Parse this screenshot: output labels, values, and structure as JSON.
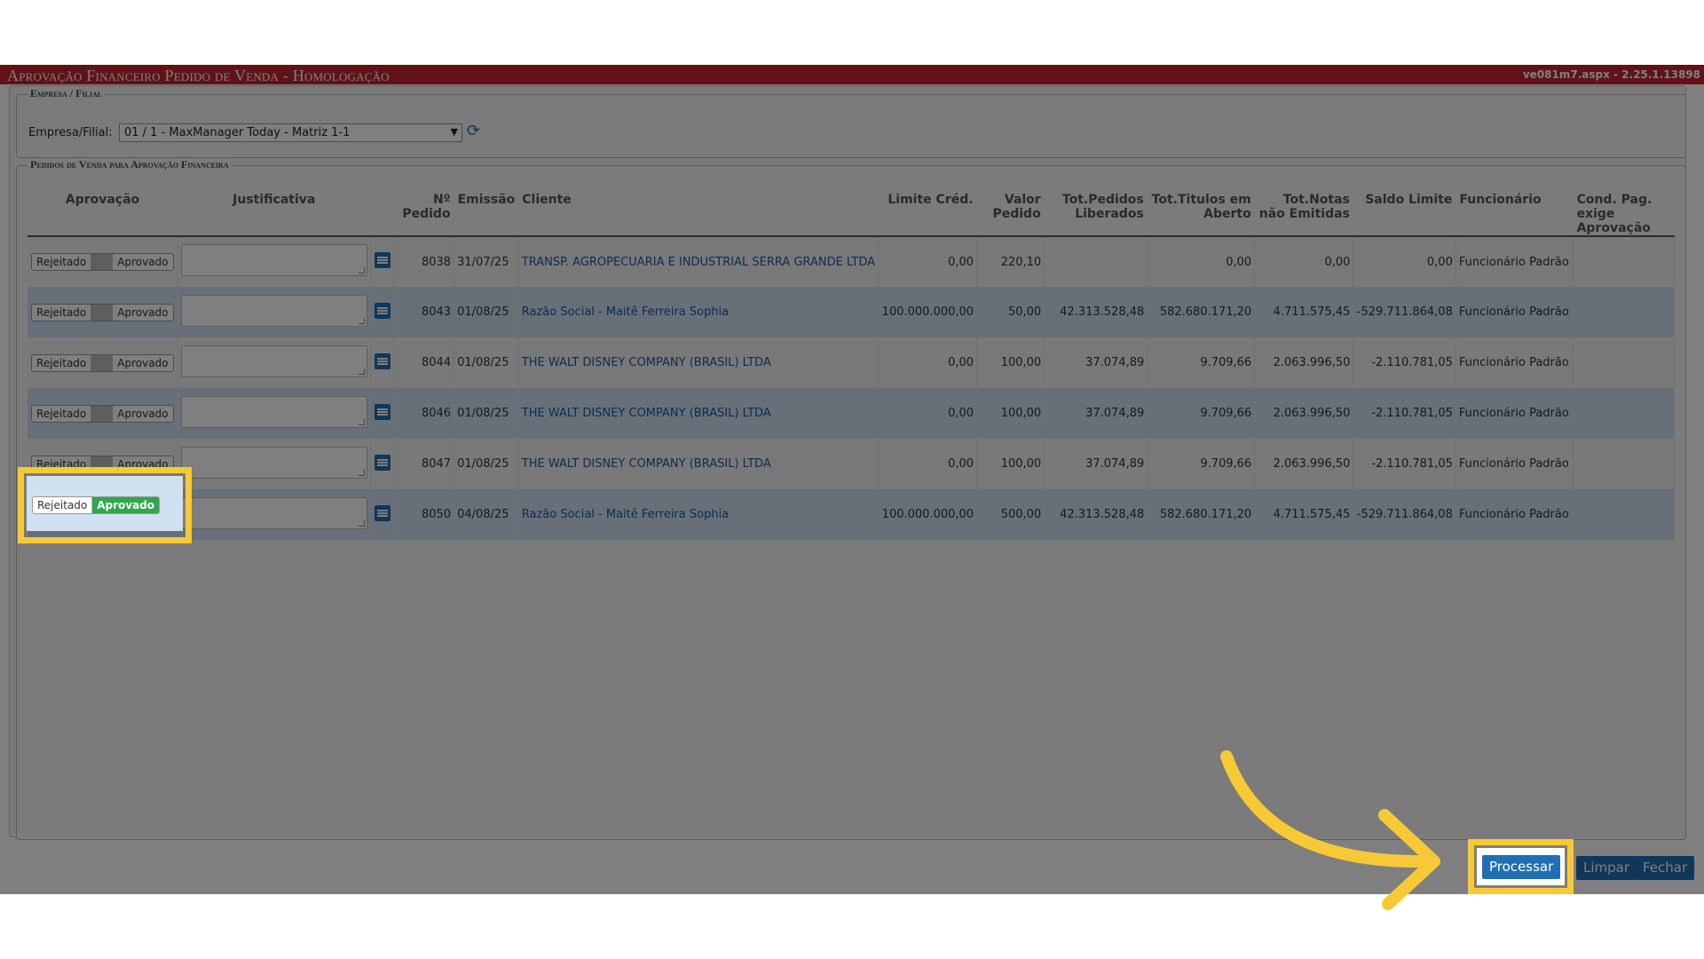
{
  "window": {
    "title": "Aprovação Financeiro Pedido de Venda  - Homologação",
    "version": "ve081m7.aspx - 2.25.1.13898"
  },
  "empresa": {
    "legend": "Empresa / Filial",
    "label": "Empresa/Filial:",
    "selected": "01 / 1 - MaxManager Today - Matriz 1-1"
  },
  "pedidos": {
    "legend": "Pedidos de Venda para Aprovação Financeira",
    "headers": {
      "aprovacao": "Aprovação",
      "justificativa": "Justificativa",
      "pedido": "Nº Pedido",
      "emissao": "Emissão",
      "cliente": "Cliente",
      "limite": "Limite Créd.",
      "valor": "Valor Pedido",
      "tot_liberados": "Tot.Pedidos Liberados",
      "tot_titulos": "Tot.Titulos em Aberto",
      "tot_notas": "Tot.Notas não Emitidas",
      "saldo": "Saldo Limite",
      "funcionario": "Funcionário",
      "cond": "Cond. Pag. exige Aprovação"
    },
    "toggle": {
      "rejeitado": "Rejeitado",
      "aprovado": "Aprovado"
    },
    "rows": [
      {
        "pedido": "8038",
        "emissao": "31/07/25",
        "cliente": "TRANSP. AGROPECUARIA E INDUSTRIAL SERRA GRANDE LTDA",
        "limite": "0,00",
        "valor": "220,10",
        "tot_liberados": "",
        "tot_titulos": "0,00",
        "tot_notas": "0,00",
        "saldo": "0,00",
        "funcionario": "Funcionário Padrão",
        "cond": "",
        "aprovado": false
      },
      {
        "pedido": "8043",
        "emissao": "01/08/25",
        "cliente": "Razão Social - Maitê Ferreira Sophia",
        "limite": "100.000.000,00",
        "valor": "50,00",
        "tot_liberados": "42.313.528,48",
        "tot_titulos": "582.680.171,20",
        "tot_notas": "4.711.575,45",
        "saldo": "-529.711.864,08",
        "funcionario": "Funcionário Padrão",
        "cond": "",
        "aprovado": false
      },
      {
        "pedido": "8044",
        "emissao": "01/08/25",
        "cliente": "THE WALT DISNEY COMPANY (BRASIL) LTDA",
        "limite": "0,00",
        "valor": "100,00",
        "tot_liberados": "37.074,89",
        "tot_titulos": "9.709,66",
        "tot_notas": "2.063.996,50",
        "saldo": "-2.110.781,05",
        "funcionario": "Funcionário Padrão",
        "cond": "",
        "aprovado": false
      },
      {
        "pedido": "8046",
        "emissao": "01/08/25",
        "cliente": "THE WALT DISNEY COMPANY (BRASIL) LTDA",
        "limite": "0,00",
        "valor": "100,00",
        "tot_liberados": "37.074,89",
        "tot_titulos": "9.709,66",
        "tot_notas": "2.063.996,50",
        "saldo": "-2.110.781,05",
        "funcionario": "Funcionário Padrão",
        "cond": "",
        "aprovado": false
      },
      {
        "pedido": "8047",
        "emissao": "01/08/25",
        "cliente": "THE WALT DISNEY COMPANY (BRASIL) LTDA",
        "limite": "0,00",
        "valor": "100,00",
        "tot_liberados": "37.074,89",
        "tot_titulos": "9.709,66",
        "tot_notas": "2.063.996,50",
        "saldo": "-2.110.781,05",
        "funcionario": "Funcionário Padrão",
        "cond": "",
        "aprovado": false
      },
      {
        "pedido": "8050",
        "emissao": "04/08/25",
        "cliente": "Razão Social - Maitê Ferreira Sophia",
        "limite": "100.000.000,00",
        "valor": "500,00",
        "tot_liberados": "42.313.528,48",
        "tot_titulos": "582.680.171,20",
        "tot_notas": "4.711.575,45",
        "saldo": "-529.711.864,08",
        "funcionario": "Funcionário Padrão",
        "cond": "",
        "aprovado": true
      }
    ]
  },
  "buttons": {
    "processar": "Processar",
    "limpar": "Limpar",
    "fechar": "Fechar"
  },
  "colors": {
    "title_bar": "#c0272d",
    "accent": "#1f6fb5",
    "approved": "#2fa84f",
    "highlight": "#f8c936"
  }
}
